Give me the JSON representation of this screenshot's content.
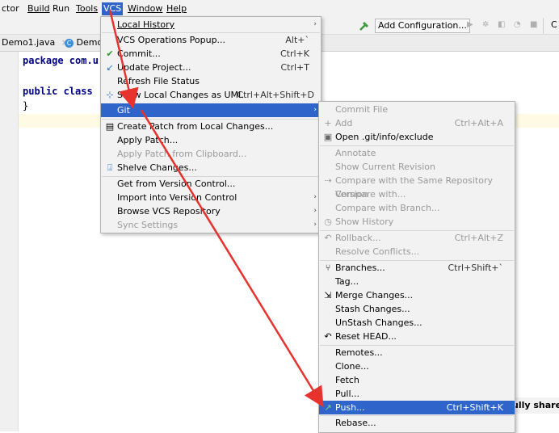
{
  "menubar": {
    "items": [
      "ctor",
      "Build",
      "Run",
      "Tools",
      "VCS",
      "Window",
      "Help"
    ],
    "active": "VCS"
  },
  "toolbar": {
    "add_configuration": "Add Configuration...",
    "cut_char": "C"
  },
  "tabs": [
    {
      "label": "Demo1.java"
    },
    {
      "label": "Demo"
    }
  ],
  "editor": {
    "lines": [
      "package com.u",
      "",
      "public class",
      "}"
    ],
    "keyword_package": "package",
    "keyword_public_class": "public class"
  },
  "vcs_menu": {
    "items": [
      {
        "label": "Local History",
        "shortcut": "",
        "submenu": true
      },
      {
        "label": "VCS Operations Popup...",
        "shortcut": "Alt+`"
      },
      {
        "label": "Commit...",
        "shortcut": "Ctrl+K"
      },
      {
        "label": "Update Project...",
        "shortcut": "Ctrl+T"
      },
      {
        "label": "Refresh File Status",
        "shortcut": ""
      },
      {
        "label": "Show Local Changes as UML",
        "shortcut": "Ctrl+Alt+Shift+D"
      },
      {
        "label": "Git",
        "shortcut": "",
        "submenu": true
      },
      {
        "label": "Create Patch from Local Changes...",
        "shortcut": ""
      },
      {
        "label": "Apply Patch...",
        "shortcut": ""
      },
      {
        "label": "Apply Patch from Clipboard...",
        "shortcut": ""
      },
      {
        "label": "Shelve Changes...",
        "shortcut": ""
      },
      {
        "label": "Get from Version Control...",
        "shortcut": ""
      },
      {
        "label": "Import into Version Control",
        "shortcut": "",
        "submenu": true
      },
      {
        "label": "Browse VCS Repository",
        "shortcut": "",
        "submenu": true
      },
      {
        "label": "Sync Settings",
        "shortcut": "",
        "submenu": true
      }
    ]
  },
  "git_menu": {
    "items": [
      {
        "label": "Commit File",
        "shortcut": ""
      },
      {
        "label": "Add",
        "shortcut": "Ctrl+Alt+A"
      },
      {
        "label": "Open .git/info/exclude",
        "shortcut": ""
      },
      {
        "label": "Annotate",
        "shortcut": ""
      },
      {
        "label": "Show Current Revision",
        "shortcut": ""
      },
      {
        "label": "Compare with the Same Repository Version",
        "shortcut": ""
      },
      {
        "label": "Compare with...",
        "shortcut": ""
      },
      {
        "label": "Compare with Branch...",
        "shortcut": ""
      },
      {
        "label": "Show History",
        "shortcut": ""
      },
      {
        "label": "Rollback...",
        "shortcut": "Ctrl+Alt+Z"
      },
      {
        "label": "Resolve Conflicts...",
        "shortcut": ""
      },
      {
        "label": "Branches...",
        "shortcut": "Ctrl+Shift+`"
      },
      {
        "label": "Tag...",
        "shortcut": ""
      },
      {
        "label": "Merge Changes...",
        "shortcut": ""
      },
      {
        "label": "Stash Changes...",
        "shortcut": ""
      },
      {
        "label": "UnStash Changes...",
        "shortcut": ""
      },
      {
        "label": "Reset HEAD...",
        "shortcut": ""
      },
      {
        "label": "Remotes...",
        "shortcut": ""
      },
      {
        "label": "Clone...",
        "shortcut": ""
      },
      {
        "label": "Fetch",
        "shortcut": ""
      },
      {
        "label": "Pull...",
        "shortcut": ""
      },
      {
        "label": "Push...",
        "shortcut": "Ctrl+Shift+K"
      },
      {
        "label": "Rebase...",
        "shortcut": ""
      }
    ]
  },
  "notification": {
    "text": "ully shared"
  },
  "colors": {
    "selection": "#2f65ca",
    "arrow": "#e8322d",
    "menu_bg": "#f2f2f2",
    "hammer_green": "#3d9a3d",
    "commit_check_green": "#2e9a2e",
    "update_arrow_blue": "#3a78c8"
  },
  "icons": {
    "build": "hammer-icon",
    "run": "play-icon",
    "debug": "bug-icon",
    "commit": "check-icon",
    "update": "update-arrow-icon",
    "uml": "uml-icon",
    "patch": "patch-icon",
    "shelve": "shelve-icon",
    "add": "plus-icon",
    "exclude": "exclude-file-icon",
    "compare": "compare-icon",
    "history": "clock-icon",
    "rollback": "rollback-icon",
    "branches": "branch-icon",
    "merge": "merge-icon",
    "reset": "reset-icon",
    "push": "push-arrow-icon"
  }
}
